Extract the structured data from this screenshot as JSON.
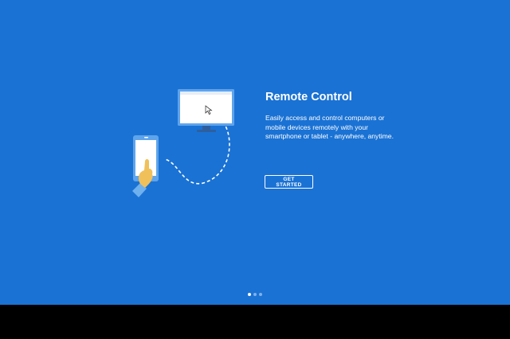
{
  "onboarding": {
    "title": "Remote Control",
    "description": "Easily access and control computers or mobile devices remotely with your smartphone or tablet - anywhere, anytime.",
    "cta_label": "GET STARTED",
    "page_indicator": {
      "current": 1,
      "total": 3
    }
  },
  "colors": {
    "background": "#1a72d4",
    "accent_dark": "#0d5bb5",
    "hand": "#f0c05a",
    "sleeve": "#6fb0ee"
  },
  "icons": [
    "remote-control-illustration-icon",
    "monitor-icon",
    "smartphone-icon",
    "cursor-icon",
    "hand-icon"
  ]
}
